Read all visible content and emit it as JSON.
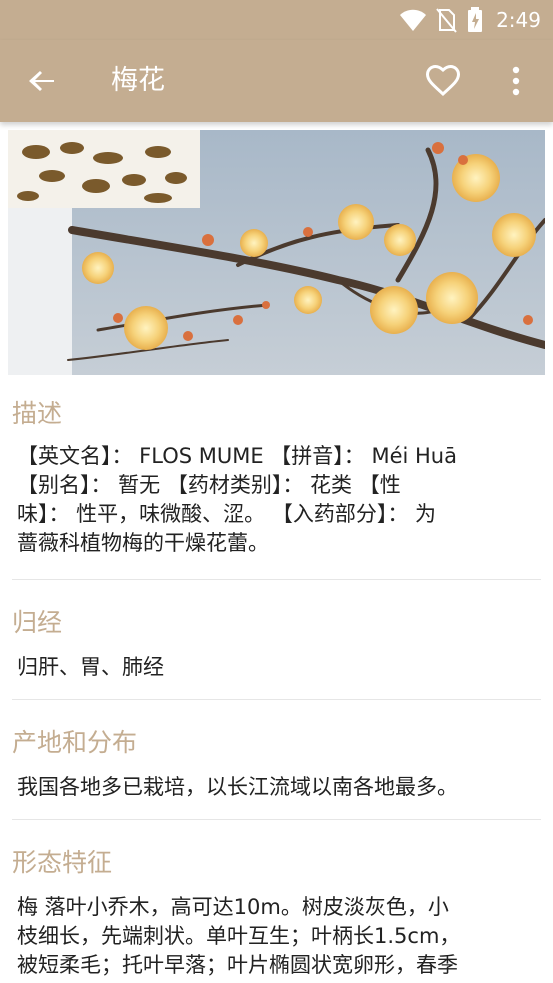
{
  "status_bar": {
    "time": "2:49",
    "icons": [
      "wifi-icon",
      "no-sim-icon",
      "battery-charging-icon"
    ]
  },
  "app_bar": {
    "title": "梅花",
    "back_icon": "arrow-left-icon",
    "favorite_icon": "heart-outline-icon",
    "more_icon": "more-vertical-icon"
  },
  "hero_image": {
    "subject": "plum blossom branch with dried flower buds inset"
  },
  "sections": [
    {
      "title": "描述",
      "body_lines": [
        "【英文名】： FLOS MUME 【拼音】： Méi Huā",
        "【别名】： 暂无 【药材类别】： 花类 【性",
        "味】： 性平，味微酸、涩。 【入药部分】： 为",
        "蔷薇科植物梅的干燥花蕾。"
      ]
    },
    {
      "title": "归经",
      "body_lines": [
        "归肝、胃、肺经"
      ]
    },
    {
      "title": "产地和分布",
      "body_lines": [
        "我国各地多已栽培，以长江流域以南各地最多。"
      ]
    },
    {
      "title": "形态特征",
      "body_lines": [
        "梅 落叶小乔木，高可达10m。树皮淡灰色，小",
        "枝细长，先端刺状。单叶互生；叶柄长1.5cm，",
        "被短柔毛；托叶早落；叶片椭圆状宽卵形，春季"
      ]
    }
  ],
  "colors": {
    "accent": "#c4ad91",
    "text": "#222222",
    "divider": "#e6e6e6"
  }
}
